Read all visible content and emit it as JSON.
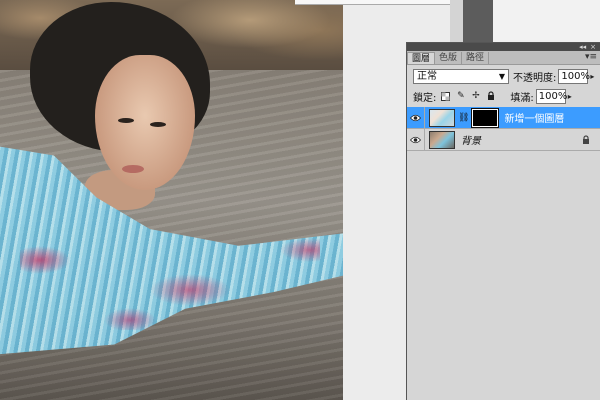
{
  "layers_panel": {
    "tabs": [
      {
        "label": "圖層",
        "active": true
      },
      {
        "label": "色版",
        "active": false
      },
      {
        "label": "路徑",
        "active": false
      }
    ],
    "collapse_glyph": "◂◂",
    "close_glyph": "×",
    "menu_glyph": "▾≡",
    "blend_mode": "正常",
    "opacity_label": "不透明度:",
    "opacity_value": "100%",
    "lock_label": "鎖定:",
    "fill_label": "填滿:",
    "fill_value": "100%",
    "layers": [
      {
        "name": "新增一個圖層",
        "visible": true,
        "selected": true,
        "has_mask": true
      },
      {
        "name": "背景",
        "visible": true,
        "selected": false,
        "locked": true
      }
    ]
  },
  "colors": {
    "selection": "#3c9cff",
    "panel_bg": "#d6d6d6"
  },
  "icons": [
    "eye-icon",
    "chain-link-icon",
    "lock-icon",
    "lock-transparent-icon",
    "lock-paint-icon",
    "lock-move-icon",
    "dropdown-arrow-icon",
    "panel-menu-icon"
  ]
}
